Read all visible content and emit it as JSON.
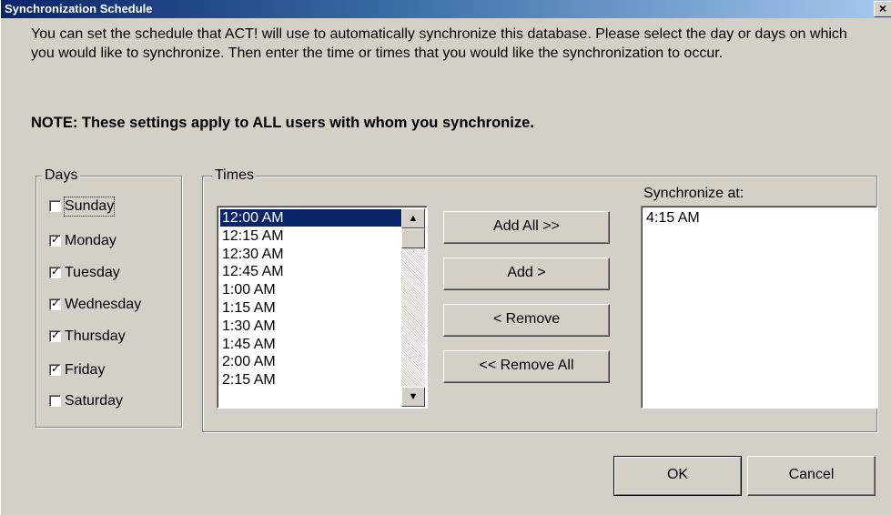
{
  "window": {
    "title": "Synchronization Schedule",
    "close_glyph": "×"
  },
  "intro": {
    "text": "You can set the schedule that ACT! will use to automatically synchronize this database.  Please select the day or days on which you would like to synchronize.  Then enter the time or times that you would like the synchronization to occur."
  },
  "note": {
    "text": "NOTE: These settings apply to ALL users with whom you synchronize."
  },
  "days": {
    "label": "Days",
    "items": [
      {
        "label": "Sunday",
        "checked": false
      },
      {
        "label": "Monday",
        "checked": true
      },
      {
        "label": "Tuesday",
        "checked": true
      },
      {
        "label": "Wednesday",
        "checked": true
      },
      {
        "label": "Thursday",
        "checked": true
      },
      {
        "label": "Friday",
        "checked": true
      },
      {
        "label": "Saturday",
        "checked": false
      }
    ],
    "check_glyph": "✓"
  },
  "times": {
    "label": "Times",
    "items": [
      "12:00 AM",
      "12:15 AM",
      "12:30 AM",
      "12:45 AM",
      "1:00 AM",
      "1:15 AM",
      "1:30 AM",
      "1:45 AM",
      "2:00 AM",
      "2:15 AM"
    ],
    "selected_index": 0,
    "scroll_up_glyph": "▲",
    "scroll_down_glyph": "▼"
  },
  "buttons": {
    "add_all": "Add All >>",
    "add": "Add >",
    "remove": "< Remove",
    "remove_all": "<< Remove All",
    "ok": "OK",
    "cancel": "Cancel"
  },
  "sync": {
    "label": "Synchronize at:",
    "items": [
      "4:15 AM"
    ]
  }
}
